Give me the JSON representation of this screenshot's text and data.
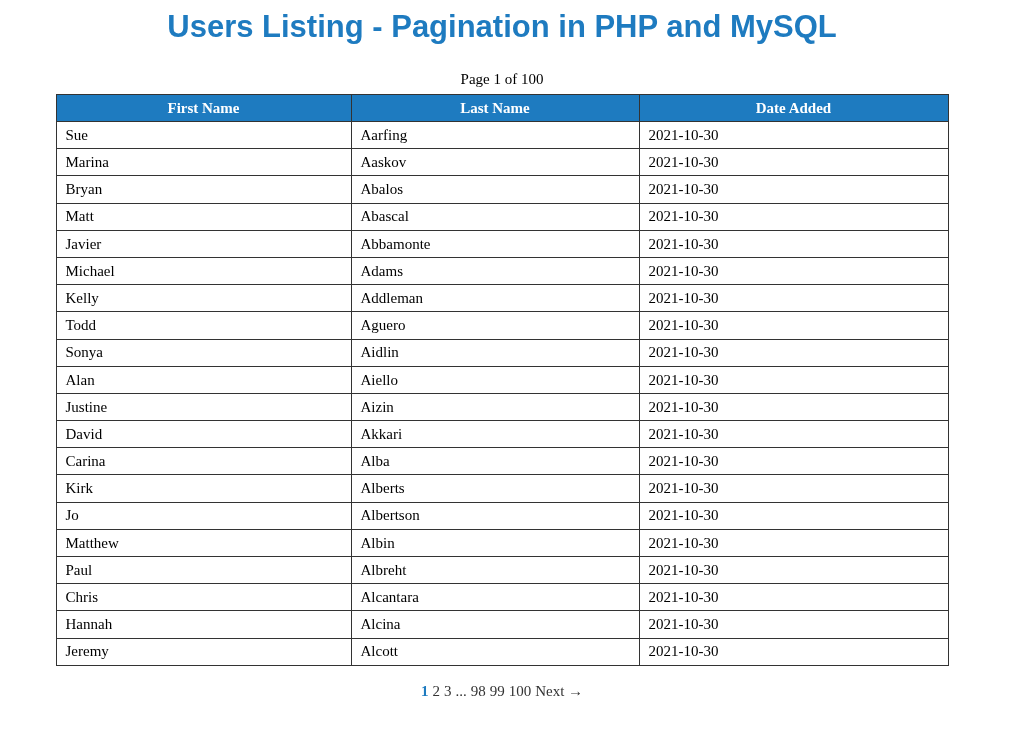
{
  "title": "Users Listing - Pagination in PHP and MySQL",
  "page_info": "Page 1 of 100",
  "table": {
    "columns": [
      "First Name",
      "Last Name",
      "Date Added"
    ],
    "rows": [
      [
        "Sue",
        "Aarfing",
        "2021-10-30"
      ],
      [
        "Marina",
        "Aaskov",
        "2021-10-30"
      ],
      [
        "Bryan",
        "Abalos",
        "2021-10-30"
      ],
      [
        "Matt",
        "Abascal",
        "2021-10-30"
      ],
      [
        "Javier",
        "Abbamonte",
        "2021-10-30"
      ],
      [
        "Michael",
        "Adams",
        "2021-10-30"
      ],
      [
        "Kelly",
        "Addleman",
        "2021-10-30"
      ],
      [
        "Todd",
        "Aguero",
        "2021-10-30"
      ],
      [
        "Sonya",
        "Aidlin",
        "2021-10-30"
      ],
      [
        "Alan",
        "Aiello",
        "2021-10-30"
      ],
      [
        "Justine",
        "Aizin",
        "2021-10-30"
      ],
      [
        "David",
        "Akkari",
        "2021-10-30"
      ],
      [
        "Carina",
        "Alba",
        "2021-10-30"
      ],
      [
        "Kirk",
        "Alberts",
        "2021-10-30"
      ],
      [
        "Jo",
        "Albertson",
        "2021-10-30"
      ],
      [
        "Matthew",
        "Albin",
        "2021-10-30"
      ],
      [
        "Paul",
        "Albreht",
        "2021-10-30"
      ],
      [
        "Chris",
        "Alcantara",
        "2021-10-30"
      ],
      [
        "Hannah",
        "Alcina",
        "2021-10-30"
      ],
      [
        "Jeremy",
        "Alcott",
        "2021-10-30"
      ]
    ]
  },
  "pagination": [
    {
      "kind": "page",
      "label": "1",
      "selected": true
    },
    {
      "kind": "page",
      "label": "2",
      "selected": false
    },
    {
      "kind": "page",
      "label": "3",
      "selected": false
    },
    {
      "kind": "ellipsis",
      "label": "..."
    },
    {
      "kind": "page",
      "label": "98",
      "selected": false
    },
    {
      "kind": "page",
      "label": "99",
      "selected": false
    },
    {
      "kind": "page",
      "label": "100",
      "selected": false
    },
    {
      "kind": "next",
      "label": "Next →"
    }
  ]
}
